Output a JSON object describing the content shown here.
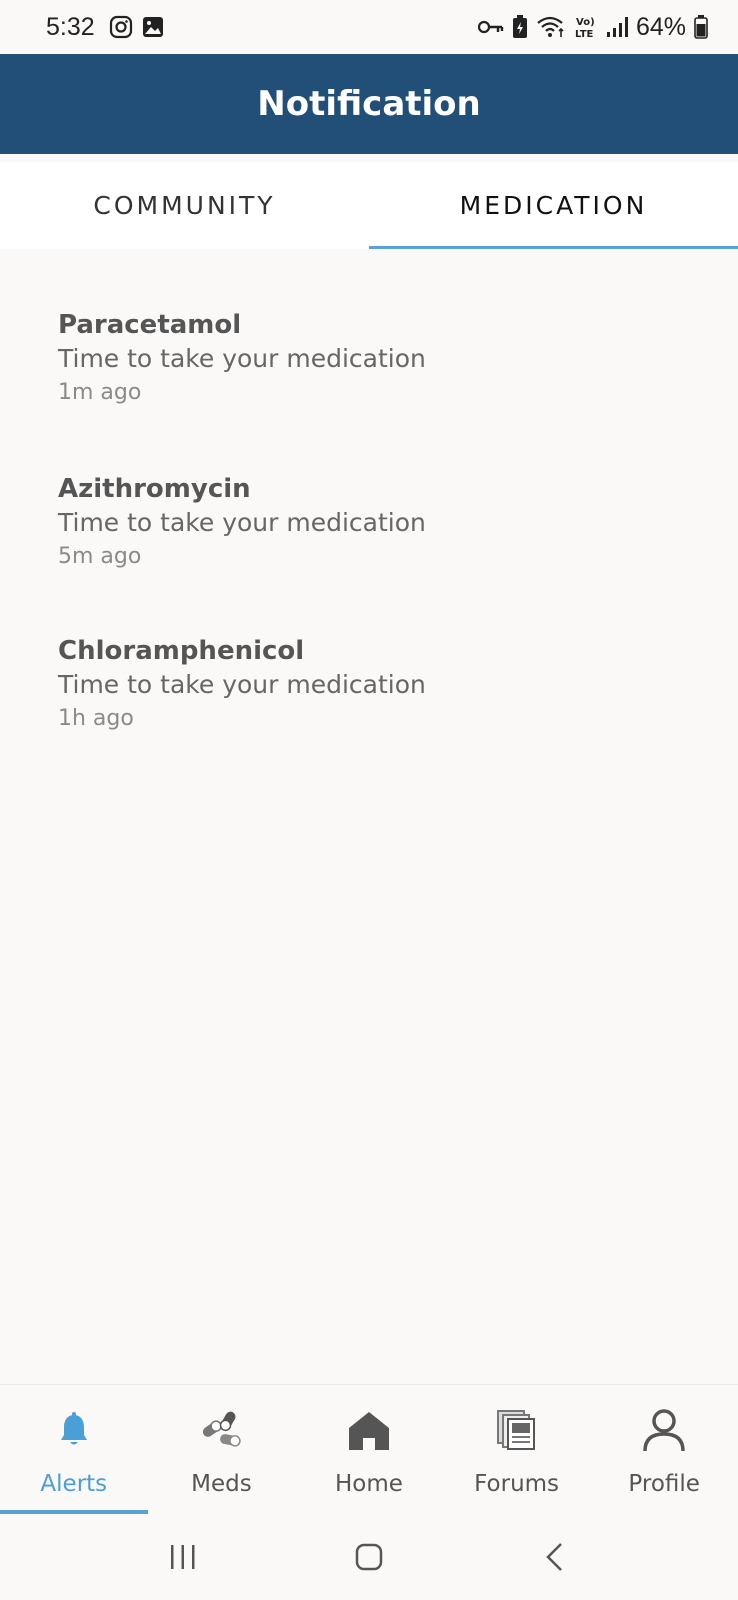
{
  "status_bar": {
    "time": "5:32",
    "battery": "64%",
    "left_icons": [
      "instagram-icon",
      "gallery-icon"
    ],
    "right_icons": [
      "vpn-key-icon",
      "battery-saver-icon",
      "wifi-icon",
      "volte-icon",
      "signal-icon",
      "battery-icon"
    ]
  },
  "app_bar": {
    "title": "Notification"
  },
  "tabs": [
    {
      "label": "COMMUNITY",
      "active": false
    },
    {
      "label": "MEDICATION",
      "active": true
    }
  ],
  "notifications": [
    {
      "title": "Paracetamol",
      "message": "Time to take your medication",
      "time": "1m ago"
    },
    {
      "title": "Azithromycin",
      "message": "Time to take your medication",
      "time": "5m ago"
    },
    {
      "title": "Chloramphenicol",
      "message": "Time to take your medication",
      "time": "1h ago"
    }
  ],
  "bottom_nav": [
    {
      "label": "Alerts",
      "icon": "bell-icon",
      "active": true
    },
    {
      "label": "Meds",
      "icon": "pills-icon",
      "active": false
    },
    {
      "label": "Home",
      "icon": "home-icon",
      "active": false
    },
    {
      "label": "Forums",
      "icon": "forums-icon",
      "active": false
    },
    {
      "label": "Profile",
      "icon": "person-icon",
      "active": false
    }
  ],
  "colors": {
    "app_bar": "#224f78",
    "accent": "#5aa2d6",
    "background": "#faf9f7"
  }
}
